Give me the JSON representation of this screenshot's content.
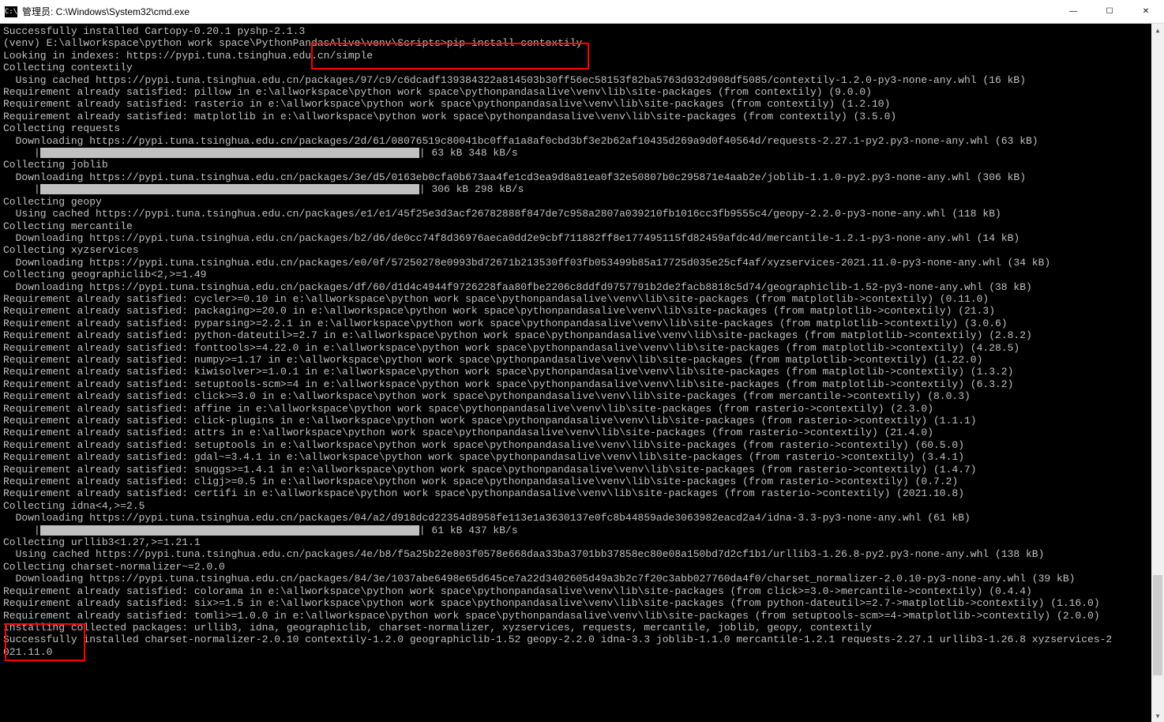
{
  "titlebar": {
    "icon_text": "C:\\",
    "title": "管理员: C:\\Windows\\System32\\cmd.exe"
  },
  "window_controls": {
    "minimize": "—",
    "maximize": "☐",
    "close": "✕"
  },
  "lines": [
    "Successfully installed Cartopy-0.20.1 pyshp-2.1.3",
    "",
    "(venv) E:\\allworkspace\\python work space\\PythonPandasAlive\\venv\\Scripts>pip install contextily",
    "Looking in indexes: https://pypi.tuna.tsinghua.edu.cn/simple",
    "Collecting contextily",
    "  Using cached https://pypi.tuna.tsinghua.edu.cn/packages/97/c9/c6dcadf139384322a814503b30ff56ec58153f82ba5763d932d908df5085/contextily-1.2.0-py3-none-any.whl (16 kB)",
    "Requirement already satisfied: pillow in e:\\allworkspace\\python work space\\pythonpandasalive\\venv\\lib\\site-packages (from contextily) (9.0.0)",
    "Requirement already satisfied: rasterio in e:\\allworkspace\\python work space\\pythonpandasalive\\venv\\lib\\site-packages (from contextily) (1.2.10)",
    "Requirement already satisfied: matplotlib in e:\\allworkspace\\python work space\\pythonpandasalive\\venv\\lib\\site-packages (from contextily) (3.5.0)",
    "Collecting requests",
    "  Downloading https://pypi.tuna.tsinghua.edu.cn/packages/2d/61/08076519c80041bc0ffa1a8af0cbd3bf3e2b62af10435d269a9d0f40564d/requests-2.27.1-py2.py3-none-any.whl (63 kB)",
    "     |████████████████████████████████████████████████████████████████| 63 kB 348 kB/s",
    "Collecting joblib",
    "  Downloading https://pypi.tuna.tsinghua.edu.cn/packages/3e/d5/0163eb0cfa0b673aa4fe1cd3ea9d8a81ea0f32e50807b0c295871e4aab2e/joblib-1.1.0-py2.py3-none-any.whl (306 kB)",
    "     |████████████████████████████████████████████████████████████████| 306 kB 298 kB/s",
    "Collecting geopy",
    "  Using cached https://pypi.tuna.tsinghua.edu.cn/packages/e1/e1/45f25e3d3acf26782888f847de7c958a2807a039210fb1016cc3fb9555c4/geopy-2.2.0-py3-none-any.whl (118 kB)",
    "Collecting mercantile",
    "  Downloading https://pypi.tuna.tsinghua.edu.cn/packages/b2/d6/de0cc74f8d36976aeca0dd2e9cbf711882ff8e177495115fd82459afdc4d/mercantile-1.2.1-py3-none-any.whl (14 kB)",
    "Collecting xyzservices",
    "  Downloading https://pypi.tuna.tsinghua.edu.cn/packages/e0/0f/57250278e0993bd72671b213530ff03fb053499b85a17725d035e25cf4af/xyzservices-2021.11.0-py3-none-any.whl (34 kB)",
    "Collecting geographiclib<2,>=1.49",
    "  Downloading https://pypi.tuna.tsinghua.edu.cn/packages/df/60/d1d4c4944f9726228faa80fbe2206c8ddfd9757791b2de2facb8818c5d74/geographiclib-1.52-py3-none-any.whl (38 kB)",
    "Requirement already satisfied: cycler>=0.10 in e:\\allworkspace\\python work space\\pythonpandasalive\\venv\\lib\\site-packages (from matplotlib->contextily) (0.11.0)",
    "Requirement already satisfied: packaging>=20.0 in e:\\allworkspace\\python work space\\pythonpandasalive\\venv\\lib\\site-packages (from matplotlib->contextily) (21.3)",
    "Requirement already satisfied: pyparsing>=2.2.1 in e:\\allworkspace\\python work space\\pythonpandasalive\\venv\\lib\\site-packages (from matplotlib->contextily) (3.0.6)",
    "Requirement already satisfied: python-dateutil>=2.7 in e:\\allworkspace\\python work space\\pythonpandasalive\\venv\\lib\\site-packages (from matplotlib->contextily) (2.8.2)",
    "Requirement already satisfied: fonttools>=4.22.0 in e:\\allworkspace\\python work space\\pythonpandasalive\\venv\\lib\\site-packages (from matplotlib->contextily) (4.28.5)",
    "Requirement already satisfied: numpy>=1.17 in e:\\allworkspace\\python work space\\pythonpandasalive\\venv\\lib\\site-packages (from matplotlib->contextily) (1.22.0)",
    "Requirement already satisfied: kiwisolver>=1.0.1 in e:\\allworkspace\\python work space\\pythonpandasalive\\venv\\lib\\site-packages (from matplotlib->contextily) (1.3.2)",
    "Requirement already satisfied: setuptools-scm>=4 in e:\\allworkspace\\python work space\\pythonpandasalive\\venv\\lib\\site-packages (from matplotlib->contextily) (6.3.2)",
    "Requirement already satisfied: click>=3.0 in e:\\allworkspace\\python work space\\pythonpandasalive\\venv\\lib\\site-packages (from mercantile->contextily) (8.0.3)",
    "Requirement already satisfied: affine in e:\\allworkspace\\python work space\\pythonpandasalive\\venv\\lib\\site-packages (from rasterio->contextily) (2.3.0)",
    "Requirement already satisfied: click-plugins in e:\\allworkspace\\python work space\\pythonpandasalive\\venv\\lib\\site-packages (from rasterio->contextily) (1.1.1)",
    "Requirement already satisfied: attrs in e:\\allworkspace\\python work space\\pythonpandasalive\\venv\\lib\\site-packages (from rasterio->contextily) (21.4.0)",
    "Requirement already satisfied: setuptools in e:\\allworkspace\\python work space\\pythonpandasalive\\venv\\lib\\site-packages (from rasterio->contextily) (60.5.0)",
    "Requirement already satisfied: gdal~=3.4.1 in e:\\allworkspace\\python work space\\pythonpandasalive\\venv\\lib\\site-packages (from rasterio->contextily) (3.4.1)",
    "Requirement already satisfied: snuggs>=1.4.1 in e:\\allworkspace\\python work space\\pythonpandasalive\\venv\\lib\\site-packages (from rasterio->contextily) (1.4.7)",
    "Requirement already satisfied: cligj>=0.5 in e:\\allworkspace\\python work space\\pythonpandasalive\\venv\\lib\\site-packages (from rasterio->contextily) (0.7.2)",
    "Requirement already satisfied: certifi in e:\\allworkspace\\python work space\\pythonpandasalive\\venv\\lib\\site-packages (from rasterio->contextily) (2021.10.8)",
    "Collecting idna<4,>=2.5",
    "  Downloading https://pypi.tuna.tsinghua.edu.cn/packages/04/a2/d918dcd22354d8958fe113e1a3630137e0fc8b44859ade3063982eacd2a4/idna-3.3-py3-none-any.whl (61 kB)",
    "     |████████████████████████████████████████████████████████████████| 61 kB 437 kB/s",
    "Collecting urllib3<1.27,>=1.21.1",
    "  Using cached https://pypi.tuna.tsinghua.edu.cn/packages/4e/b8/f5a25b22e803f0578e668daa33ba3701bb37858ec80e08a150bd7d2cf1b1/urllib3-1.26.8-py2.py3-none-any.whl (138 kB)",
    "Collecting charset-normalizer~=2.0.0",
    "  Downloading https://pypi.tuna.tsinghua.edu.cn/packages/84/3e/1037abe6498e65d645ce7a22d3402605d49a3b2c7f20c3abb027760da4f0/charset_normalizer-2.0.10-py3-none-any.whl (39 kB)",
    "Requirement already satisfied: colorama in e:\\allworkspace\\python work space\\pythonpandasalive\\venv\\lib\\site-packages (from click>=3.0->mercantile->contextily) (0.4.4)",
    "Requirement already satisfied: six>=1.5 in e:\\allworkspace\\python work space\\pythonpandasalive\\venv\\lib\\site-packages (from python-dateutil>=2.7->matplotlib->contextily) (1.16.0)",
    "Requirement already satisfied: tomli>=1.0.0 in e:\\allworkspace\\python work space\\pythonpandasalive\\venv\\lib\\site-packages (from setuptools-scm>=4->matplotlib->contextily) (2.0.0)",
    "Installing collected packages: urllib3, idna, geographiclib, charset-normalizer, xyzservices, requests, mercantile, joblib, geopy, contextily",
    "Successfully installed charset-normalizer-2.0.10 contextily-1.2.0 geographiclib-1.52 geopy-2.2.0 idna-3.3 joblib-1.1.0 mercantile-1.2.1 requests-2.27.1 urllib3-1.26.8 xyzservices-2",
    "021.11.0"
  ]
}
